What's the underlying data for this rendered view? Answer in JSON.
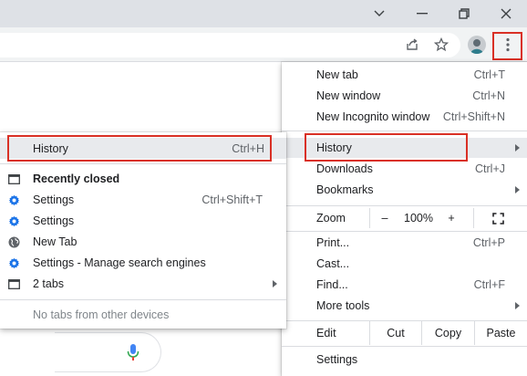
{
  "main_menu": {
    "items": [
      {
        "label": "New tab",
        "shortcut": "Ctrl+T"
      },
      {
        "label": "New window",
        "shortcut": "Ctrl+N"
      },
      {
        "label": "New Incognito window",
        "shortcut": "Ctrl+Shift+N"
      },
      {
        "label": "History",
        "shortcut": ""
      },
      {
        "label": "Downloads",
        "shortcut": "Ctrl+J"
      },
      {
        "label": "Bookmarks",
        "shortcut": ""
      }
    ],
    "zoom": {
      "label": "Zoom",
      "minus": "–",
      "value": "100%",
      "plus": "+"
    },
    "items2": [
      {
        "label": "Print...",
        "shortcut": "Ctrl+P"
      },
      {
        "label": "Cast...",
        "shortcut": ""
      },
      {
        "label": "Find...",
        "shortcut": "Ctrl+F"
      },
      {
        "label": "More tools",
        "shortcut": ""
      }
    ],
    "edit": {
      "label": "Edit",
      "cut": "Cut",
      "copy": "Copy",
      "paste": "Paste"
    },
    "settings": "Settings"
  },
  "history_submenu": {
    "history": {
      "label": "History",
      "shortcut": "Ctrl+H"
    },
    "recently_closed": "Recently closed",
    "entries": [
      {
        "label": "Settings",
        "shortcut": "Ctrl+Shift+T",
        "icon": "gear-icon"
      },
      {
        "label": "Settings",
        "shortcut": "",
        "icon": "gear-icon"
      },
      {
        "label": "New Tab",
        "shortcut": "",
        "icon": "globe-icon"
      },
      {
        "label": "Settings - Manage search engines",
        "shortcut": "",
        "icon": "gear-icon"
      },
      {
        "label": "2 tabs",
        "shortcut": "",
        "icon": "window-icon"
      }
    ],
    "no_tabs": "No tabs from other devices"
  },
  "colors": {
    "highlight_border": "#d93025",
    "gear_blue": "#1a73e8"
  }
}
